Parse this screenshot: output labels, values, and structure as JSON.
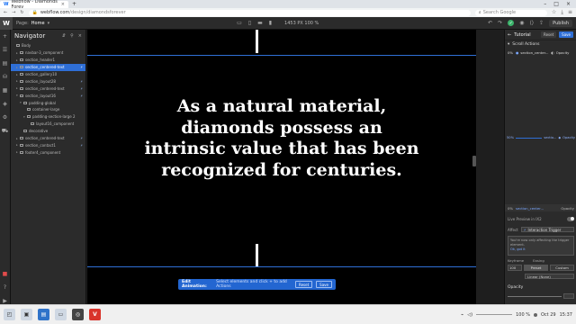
{
  "browser": {
    "tab_title": "Webflow - Diamonds Forev",
    "tab_close": "×",
    "new_tab": "+",
    "url_host": "webflow.com",
    "url_path": "/design/diamondsforever",
    "search_placeholder": "Search Google"
  },
  "webflow": {
    "logo": "W",
    "page_label": "Page:",
    "page_name": "Home",
    "dimensions": "1453 PX   100 %",
    "publish_label": "Publish",
    "check": "✓"
  },
  "navigator": {
    "title": "Navigator",
    "items": [
      {
        "label": "Body",
        "indent": 0,
        "caret": "",
        "selected": false,
        "interaction": false
      },
      {
        "label": "navbar-3_component",
        "indent": 1,
        "caret": "▸",
        "selected": false,
        "interaction": false
      },
      {
        "label": "section_header1",
        "indent": 1,
        "caret": "▸",
        "selected": false,
        "interaction": false
      },
      {
        "label": "section_centered-text",
        "indent": 1,
        "caret": "▸",
        "selected": true,
        "interaction": true
      },
      {
        "label": "section_gallery10",
        "indent": 1,
        "caret": "▸",
        "selected": false,
        "interaction": false
      },
      {
        "label": "section_layout28",
        "indent": 1,
        "caret": "▸",
        "selected": false,
        "interaction": true
      },
      {
        "label": "section_centered-text",
        "indent": 1,
        "caret": "▸",
        "selected": false,
        "interaction": true
      },
      {
        "label": "section_layout16",
        "indent": 1,
        "caret": "▾",
        "selected": false,
        "interaction": true
      },
      {
        "label": "padding-global",
        "indent": 2,
        "caret": "▾",
        "selected": false,
        "interaction": false
      },
      {
        "label": "container-large",
        "indent": 3,
        "caret": "",
        "selected": false,
        "interaction": false
      },
      {
        "label": "padding-section-large 2",
        "indent": 3,
        "caret": "▾",
        "selected": false,
        "interaction": false
      },
      {
        "label": "layout16_component",
        "indent": 4,
        "caret": "",
        "selected": false,
        "interaction": false
      },
      {
        "label": "decorative",
        "indent": 2,
        "caret": "",
        "selected": false,
        "interaction": false
      },
      {
        "label": "section_centered-text",
        "indent": 1,
        "caret": "▸",
        "selected": false,
        "interaction": true
      },
      {
        "label": "section_contact1",
        "indent": 1,
        "caret": "▸",
        "selected": false,
        "interaction": true
      },
      {
        "label": "footer4_component",
        "indent": 1,
        "caret": "▸",
        "selected": false,
        "interaction": false
      }
    ]
  },
  "canvas": {
    "headline": "As a natural material, diamonds possess an intrinsic value that has been recognized for centuries."
  },
  "edit_animation": {
    "title": "Edit Animation:",
    "message": "Select elements and click + to add Actions",
    "reset": "Reset",
    "save": "Save"
  },
  "right_panel": {
    "title": "Tutorial",
    "reset": "Reset",
    "save": "Save",
    "section_title": "Scroll Actions",
    "row0_pct": "0%",
    "row0_target": "section_center...",
    "row0_prop": "Opacity",
    "timeline_pct": "50%",
    "timeline_target": "sectio...",
    "timeline_prop": "Opacity",
    "anim_label": "0%",
    "anim_target": "section_center...",
    "anim_prop": "Opacity",
    "live_preview": "Live Preview in IX2",
    "affect_label": "Affect",
    "affect_value": "Interaction Trigger",
    "note": "You're now only affecting the trigger element.",
    "note_link": "Ok, got it",
    "keyframe_label": "Keyframe",
    "easing_label": "Easing",
    "kf_value": "100",
    "preset": "Preset",
    "custom": "Custom",
    "ease_value": "Linear (None)",
    "opacity_title": "Opacity"
  },
  "taskbar": {
    "zoom": "100 %",
    "date": "Oct 29",
    "time": "15:37"
  }
}
